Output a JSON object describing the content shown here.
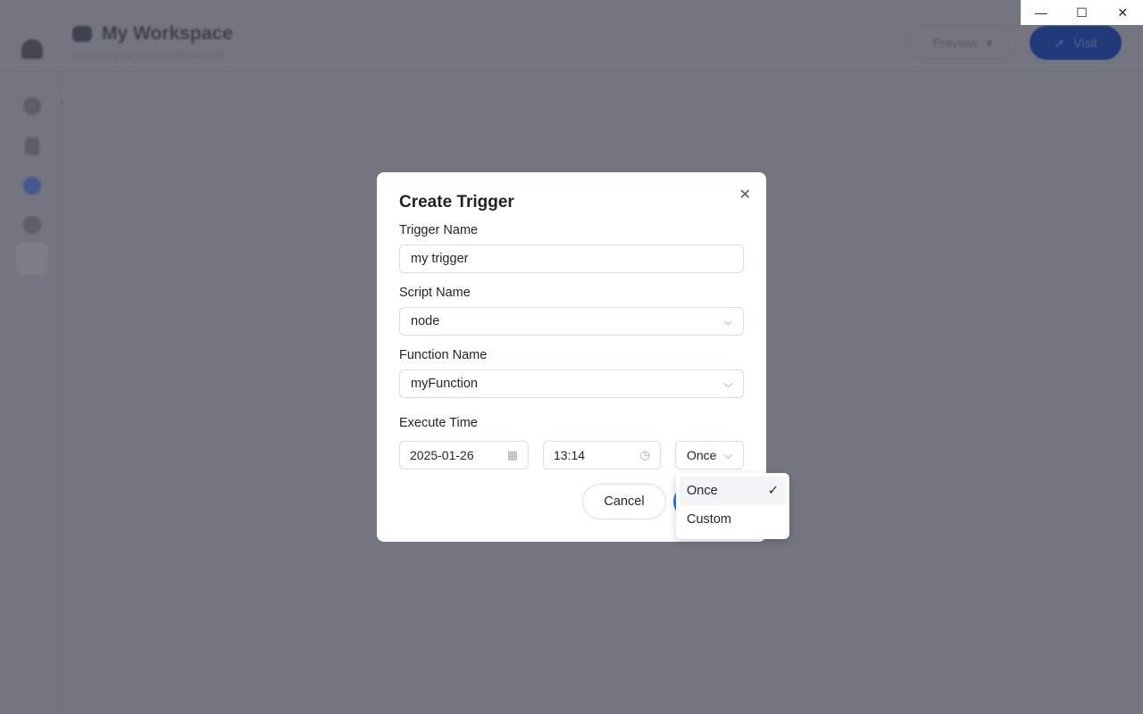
{
  "header": {
    "title": "My Workspace",
    "subtitle": "Go turn your ideas into action!",
    "preview_label": "Preview",
    "visit_label": "Visit"
  },
  "window_controls": {
    "minimize": "—",
    "maximize": "☐",
    "close": "✕"
  },
  "sidebar": {
    "items": [
      {
        "icon": "code-icon"
      },
      {
        "icon": "clipboard-icon"
      },
      {
        "icon": "trigger-icon",
        "active": true
      },
      {
        "icon": "settings-icon"
      }
    ]
  },
  "modal": {
    "title": "Create Trigger",
    "trigger_name": {
      "label": "Trigger Name",
      "value": "my trigger"
    },
    "script_name": {
      "label": "Script Name",
      "value": "node"
    },
    "function_name": {
      "label": "Function Name",
      "value": "myFunction"
    },
    "execute_time": {
      "label": "Execute Time",
      "date": "2025-01-26",
      "time": "13:14",
      "repeat": "Once"
    },
    "cancel_label": "Cancel"
  },
  "repeat_dropdown": {
    "options": [
      {
        "label": "Once",
        "selected": true
      },
      {
        "label": "Custom",
        "selected": false
      }
    ]
  },
  "colors": {
    "overlay": "#737580",
    "primary": "#2f6df6"
  }
}
